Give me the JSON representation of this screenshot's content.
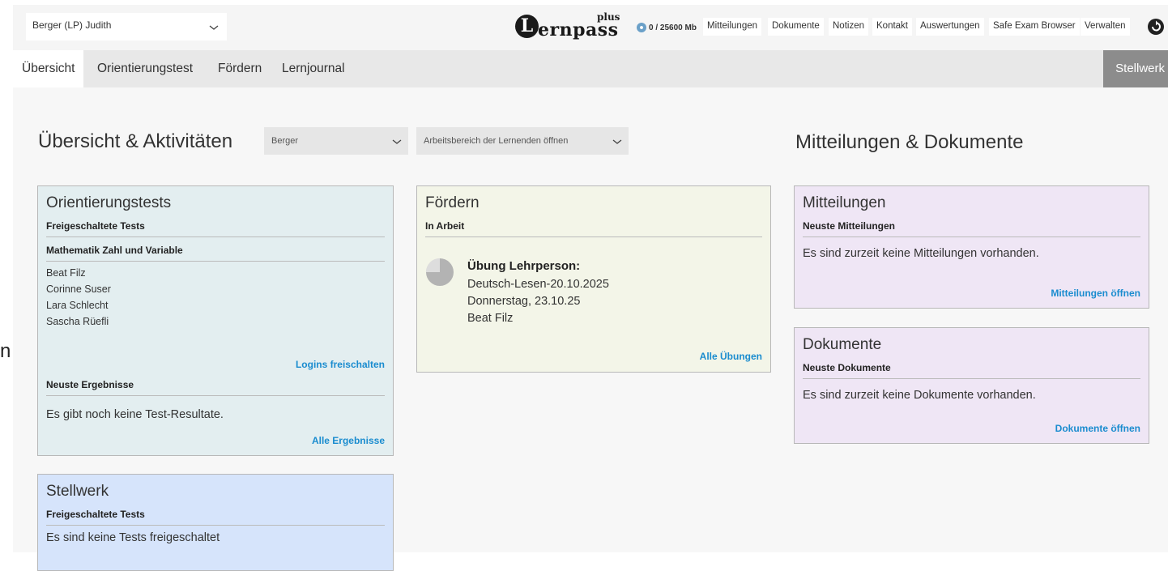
{
  "header": {
    "user_select": "Berger (LP) Judith",
    "logo_plus": "plus",
    "logo_initial": "L",
    "logo_word": "ernpass",
    "storage": "0 / 25600 Mb",
    "menu": [
      "Mitteilungen",
      "Dokumente",
      "Notizen",
      "Kontakt",
      "Auswertungen",
      "Safe Exam Browser",
      "Verwalten"
    ]
  },
  "tabs": {
    "items": [
      "Übersicht",
      "Orientierungstest",
      "Fördern",
      "Lernjournal"
    ],
    "active": "Übersicht",
    "right": "Stellwerk"
  },
  "stray_text": "n",
  "overview": {
    "title": "Übersicht & Aktivitäten",
    "teacher_select": "Berger",
    "workspace_select": "Arbeitsbereich der Lernenden öffnen"
  },
  "orientierungstests": {
    "title": "Orientierungstests",
    "released_heading": "Freigeschaltete Tests",
    "subject_heading": "Mathematik Zahl und Variable",
    "students": [
      "Beat Filz",
      "Corinne Suser",
      "Lara Schlecht",
      "Sascha Rüefli"
    ],
    "logins_link": "Logins freischalten",
    "results_heading": "Neuste Ergebnisse",
    "results_empty": "Es gibt noch keine Test-Resultate.",
    "results_link": "Alle Ergebnisse"
  },
  "stellwerk": {
    "title": "Stellwerk",
    "released_heading": "Freigeschaltete Tests",
    "empty": "Es sind keine Tests freigeschaltet"
  },
  "foerdern": {
    "title": "Fördern",
    "in_work_heading": "In Arbeit",
    "item_title": "Übung Lehrperson:",
    "item_name": "Deutsch-Lesen-20.10.2025",
    "item_date": "Donnerstag, 23.10.25",
    "item_student": "Beat Filz",
    "link": "Alle Übungen"
  },
  "messages_docs": {
    "title": "Mitteilungen & Dokumente",
    "messages": {
      "title": "Mitteilungen",
      "heading": "Neuste Mitteilungen",
      "empty": "Es sind zurzeit keine Mitteilungen vorhanden.",
      "link": "Mitteilungen öffnen"
    },
    "documents": {
      "title": "Dokumente",
      "heading": "Neuste Dokumente",
      "empty": "Es sind zurzeit keine Dokumente vorhanden.",
      "link": "Dokumente öffnen"
    }
  },
  "colors": {
    "link": "#1a8ccf",
    "orientierung_bg": "#e3eef0",
    "stellwerk_bg": "#d6e4fb",
    "foerdern_bg": "#f3f5e8",
    "messages_bg": "#efe6f5",
    "inactive_tab_bg": "#e8e8e8",
    "stellwerk_tab_bg": "#8c8c8c"
  }
}
